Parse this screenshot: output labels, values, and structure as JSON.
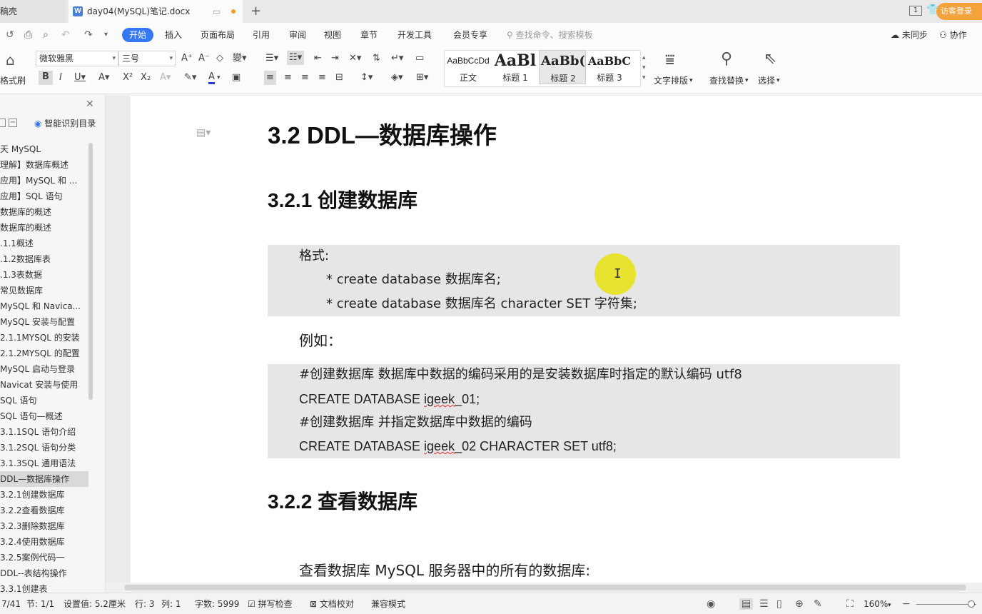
{
  "titlebar": {
    "prev_tab_label": "稿壳",
    "doc_tab_label": "day04(MySQL)笔记.docx",
    "doc_icon_letter": "W",
    "page_count_badge": "1",
    "login_label": "访客登录",
    "add_tab_glyph": "+"
  },
  "menubar": {
    "items": [
      "开始",
      "插入",
      "页面布局",
      "引用",
      "审阅",
      "视图",
      "章节",
      "开发工具",
      "会员专享"
    ],
    "search_placeholder": "查找命令、搜索模板",
    "sync_label": "未同步",
    "collab_label": "协作"
  },
  "ribbon": {
    "format_painter_label": "格式刷",
    "font_name": "微软雅黑",
    "font_size": "三号",
    "styles": [
      {
        "sample": "AaBbCcDd",
        "name": "正文"
      },
      {
        "sample": "AaBl",
        "name": "标题 1"
      },
      {
        "sample": "AaBb(",
        "name": "标题 2"
      },
      {
        "sample": "AaBbC",
        "name": "标题 3"
      }
    ],
    "text_layout_label": "文字排版",
    "find_replace_label": "查找替换",
    "select_label": "选择"
  },
  "nav": {
    "smart_toc_label": "智能识别目录",
    "items": [
      {
        "label": "天 MySQL",
        "selected": false
      },
      {
        "label": "理解】数据库概述",
        "selected": false
      },
      {
        "label": "应用】MySQL 和 ...",
        "selected": false
      },
      {
        "label": "应用】SQL 语句",
        "selected": false
      },
      {
        "label": "数据库的概述",
        "selected": false
      },
      {
        "label": "数据库的概述",
        "selected": false
      },
      {
        "label": ".1.1概述",
        "selected": false
      },
      {
        "label": ".1.2数据库表",
        "selected": false
      },
      {
        "label": ".1.3表数据",
        "selected": false
      },
      {
        "label": "常见数据库",
        "selected": false
      },
      {
        "label": "MySQL 和 Navica...",
        "selected": false
      },
      {
        "label": "MySQL 安装与配置",
        "selected": false
      },
      {
        "label": "2.1.1MYSQL 的安装",
        "selected": false
      },
      {
        "label": "2.1.2MYSQL 的配置",
        "selected": false
      },
      {
        "label": "MySQL 启动与登录",
        "selected": false
      },
      {
        "label": "Navicat 安装与使用",
        "selected": false
      },
      {
        "label": "SQL 语句",
        "selected": false
      },
      {
        "label": "SQL 语句—概述",
        "selected": false
      },
      {
        "label": "3.1.1SQL 语句介绍",
        "selected": false
      },
      {
        "label": "3.1.2SQL 语句分类",
        "selected": false
      },
      {
        "label": "3.1.3SQL 通用语法",
        "selected": false
      },
      {
        "label": "DDL—数据库操作",
        "selected": true
      },
      {
        "label": "3.2.1创建数据库",
        "selected": false
      },
      {
        "label": "3.2.2查看数据库",
        "selected": false
      },
      {
        "label": "3.2.3删除数据库",
        "selected": false
      },
      {
        "label": "3.2.4使用数据库",
        "selected": false
      },
      {
        "label": "3.2.5案例代码一",
        "selected": false
      },
      {
        "label": "DDL--表结构操作",
        "selected": false
      },
      {
        "label": "3.3.1创建表",
        "selected": false
      }
    ]
  },
  "document": {
    "h_section": "3.2 DDL—数据库操作",
    "h_sub1": "3.2.1 创建数据库",
    "format_block": {
      "label": "格式:",
      "lines": [
        "* create database  数据库名;",
        "* create database  数据库名  character SET  字符集;"
      ]
    },
    "example_label": "例如：",
    "example_block": {
      "comment1": "#创建数据库  数据库中数据的编码采用的是安装数据库时指定的默认编码  utf8",
      "sql1_prefix": "CREATE DATABASE ",
      "sql1_name": "igeek",
      "sql1_suffix": "_01;",
      "comment2": "#创建数据库  并指定数据库中数据的编码",
      "sql2_prefix": "CREATE DATABASE ",
      "sql2_name": "igeek",
      "sql2_suffix": "_02 CHARACTER SET  utf8;"
    },
    "h_sub2": "3.2.2 查看数据库",
    "view_para": "查看数据库 MySQL 服务器中的所有的数据库:"
  },
  "statusbar": {
    "page_info": "7/41",
    "section": "节: 1/1",
    "setting": "设置值: 5.2厘米",
    "row": "行: 3",
    "col": "列: 1",
    "word_count": "字数: 5999",
    "spell_check": "拼写检查",
    "doc_proof": "文档校对",
    "compat_mode": "兼容模式",
    "zoom": "160%"
  },
  "colors": {
    "accent": "#3478f6",
    "login": "#f6a23a",
    "code_bg": "#e6e6e6",
    "cursor_highlight": "#e7e21a"
  }
}
